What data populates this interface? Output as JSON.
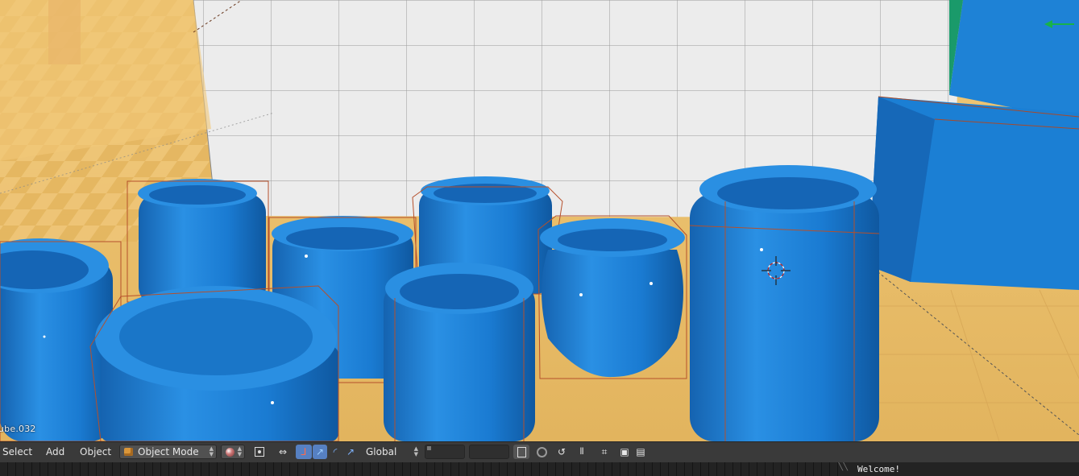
{
  "viewport": {
    "active_object_label": "ube.032"
  },
  "header": {
    "menu": {
      "select_label": "Select",
      "add_label": "Add",
      "object_label": "Object"
    },
    "mode": {
      "selected": "Object Mode",
      "icon": "object-cube-icon"
    },
    "viewport_shading": {
      "icon": "shading-sphere-icon"
    },
    "pivot": {
      "icon": "pivot-point-icon"
    },
    "manipulator": {
      "icons": [
        "translate-arrow-icon",
        "rotate-arc-icon",
        "scale-icon"
      ],
      "orientation": "Global"
    },
    "layers": {
      "icon": "layers-icon"
    },
    "proportional": {
      "icon": "proportional-edit-icon"
    },
    "snap": {
      "icon": "snap-magnet-icon"
    },
    "render_icons": [
      "render-camera-icon",
      "render-clapboard-icon"
    ]
  },
  "info": {
    "message": "Welcome!"
  },
  "colors": {
    "object_blue": "#1a82d8",
    "floor_tile": "#e8c070",
    "wall_tile": "#e6e6e6",
    "selection_outline": "#c0502a",
    "header_bg": "#3a3a3a",
    "highlight_blue": "#5680c2"
  }
}
